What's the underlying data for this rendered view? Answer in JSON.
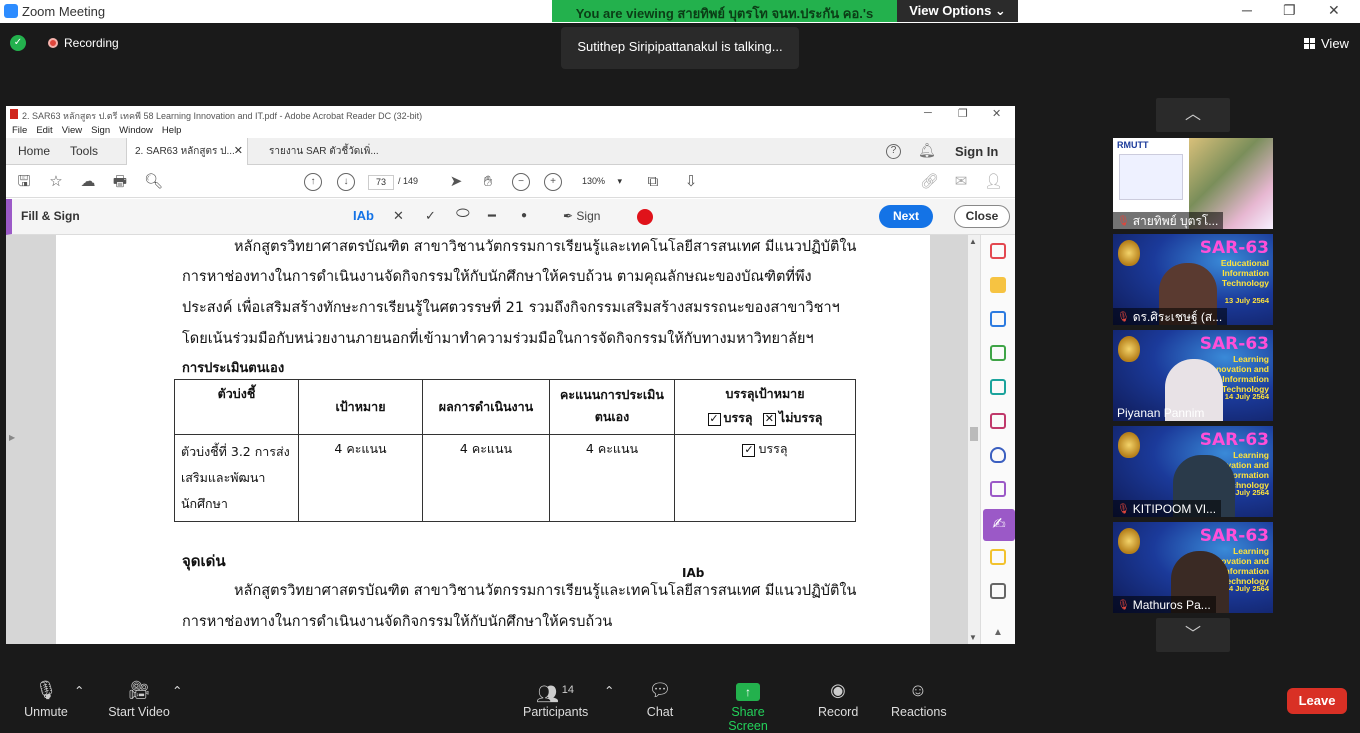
{
  "zoom": {
    "window_title": "Zoom Meeting",
    "share_banner": {
      "viewing_text": "You are viewing สายทิพย์ บุตรโท จนท.ประกัน คอ.'s screen",
      "view_options_label": "View Options ⌄"
    },
    "recording_label": "Recording",
    "talking_text": "Sutithep Siripipattanakul is talking...",
    "view_label": "View",
    "gallery": [
      {
        "name": "สายทิพย์ บุตรโ...",
        "tile_text": "",
        "date": ""
      },
      {
        "name": "ดร.ศิระเชษฐ์ (ส...",
        "tile_text": "Educational Information Technology",
        "sar": "SAR-63",
        "date": "13 July 2564"
      },
      {
        "name": "Piyanan Pannim",
        "tile_text": "Learning Innovation and Information Technology",
        "sar": "SAR-63",
        "date": "14 July 2564"
      },
      {
        "name": "KITIPOOM VI...",
        "tile_text": "Learning Innovation and Information Technology",
        "sar": "SAR-63",
        "date": "14 July 2564"
      },
      {
        "name": "Mathuros Pa...",
        "tile_text": "Learning Innovation and Information Technology",
        "sar": "SAR-63",
        "date": "14 July 2564"
      }
    ],
    "tile1_header": "RMUTT",
    "bottom": {
      "unmute": "Unmute",
      "start_video": "Start Video",
      "participants": "Participants",
      "participants_count": "14",
      "chat": "Chat",
      "share_screen": "Share Screen",
      "record": "Record",
      "reactions": "Reactions",
      "leave": "Leave"
    },
    "colors": {
      "accent_green": "#23b14d",
      "leave_red": "#d93025"
    }
  },
  "acrobat": {
    "title": "2. SAR63 หลักสูตร ป.ตรี เทคพี 58 Learning Innovation and IT.pdf - Adobe Acrobat Reader DC (32-bit)",
    "menu": [
      "File",
      "Edit",
      "View",
      "Sign",
      "Window",
      "Help"
    ],
    "tabs": {
      "home": "Home",
      "tools": "Tools",
      "doc1": "2. SAR63 หลักสูตร ป...",
      "doc2": "รายงาน SAR ตัวชี้วัดเพิ่..."
    },
    "sign_in": "Sign In",
    "page_current": "73",
    "page_total": "/ 149",
    "zoom_level": "130%",
    "fill_sign": {
      "label": "Fill & Sign",
      "text_tool": "IAb",
      "sign_label": "Sign",
      "next": "Next",
      "close": "Close"
    },
    "doc": {
      "para1": [
        "หลักสูตรวิทยาศาสตรบัณฑิต สาขาวิชานวัตกรรมการเรียนรู้และเทคโนโลยีสารสนเทศ มีแนวปฏิบัติใน",
        "การหาช่องทางในการดำเนินงานจัดกิจกรรมให้กับนักศึกษาให้ครบถ้วน ตามคุณลักษณะของบัณฑิตที่พึง",
        "ประสงค์ เพื่อเสริมสร้างทักษะการเรียนรู้ในศตวรรษที่ 21 รวมถึงกิจกรรมเสริมสร้างสมรรถนะของสาขาวิชาฯ",
        "โดยเน้นร่วมมือกับหน่วยงานภายนอกที่เข้ามาทำความร่วมมือในการจัดกิจกรรมให้กับทางมหาวิทยาลัยฯ"
      ],
      "self_eval_heading": "การประเมินตนเอง",
      "table": {
        "headers": [
          "ตัวบ่งชี้",
          "เป้าหมาย",
          "ผลการดำเนินงาน",
          "คะแนนการประเมินตนเอง",
          "บรรลุเป้าหมาย"
        ],
        "header_sub": {
          "achieved": "บรรลุ",
          "not_achieved": "ไม่บรรลุ"
        },
        "row": {
          "indicator": "ตัวบ่งชี้ที่ 3.2 การส่งเสริมและพัฒนานักศึกษา",
          "target": "4 คะแนน",
          "result": "4 คะแนน",
          "score": "4 คะแนน",
          "achieved": "บรรลุ"
        }
      },
      "highlight_heading": "จุดเด่น",
      "para2": [
        "หลักสูตรวิทยาศาสตรบัณฑิต สาขาวิชานวัตกรรมการเรียนรู้และเทคโนโลยีสารสนเทศ มีแนวปฏิบัติใน",
        "การหาช่องทางในการดำเนินงานจัดกิจกรรมให้กับนักศึกษาให้ครบถ้วน"
      ],
      "cursor_text": "IAb"
    }
  }
}
